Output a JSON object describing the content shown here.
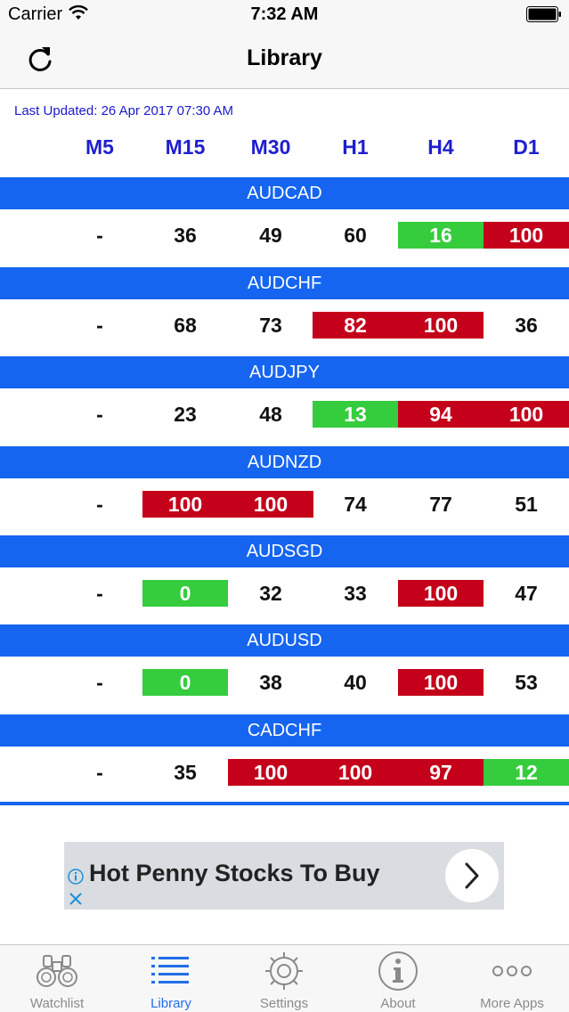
{
  "status": {
    "carrier": "Carrier",
    "time": "7:32 AM"
  },
  "nav": {
    "title": "Library"
  },
  "last_updated": "Last Updated: 26 Apr 2017 07:30 AM",
  "columns": [
    "M5",
    "M15",
    "M30",
    "H1",
    "H4",
    "D1"
  ],
  "pairs": [
    {
      "name": "AUDCAD",
      "values": [
        "-",
        "36",
        "49",
        "60",
        "16",
        "100"
      ],
      "states": [
        "none",
        "none",
        "none",
        "none",
        "green",
        "red"
      ]
    },
    {
      "name": "AUDCHF",
      "values": [
        "-",
        "68",
        "73",
        "82",
        "100",
        "36"
      ],
      "states": [
        "none",
        "none",
        "none",
        "red",
        "red",
        "none"
      ]
    },
    {
      "name": "AUDJPY",
      "values": [
        "-",
        "23",
        "48",
        "13",
        "94",
        "100"
      ],
      "states": [
        "none",
        "none",
        "none",
        "green",
        "red",
        "red"
      ]
    },
    {
      "name": "AUDNZD",
      "values": [
        "-",
        "100",
        "100",
        "74",
        "77",
        "51"
      ],
      "states": [
        "none",
        "red",
        "red",
        "none",
        "none",
        "none"
      ]
    },
    {
      "name": "AUDSGD",
      "values": [
        "-",
        "0",
        "32",
        "33",
        "100",
        "47"
      ],
      "states": [
        "none",
        "green",
        "none",
        "none",
        "red",
        "none"
      ]
    },
    {
      "name": "AUDUSD",
      "values": [
        "-",
        "0",
        "38",
        "40",
        "100",
        "53"
      ],
      "states": [
        "none",
        "green",
        "none",
        "none",
        "red",
        "none"
      ]
    },
    {
      "name": "CADCHF",
      "values": [
        "-",
        "35",
        "100",
        "100",
        "97",
        "12"
      ],
      "states": [
        "none",
        "none",
        "red",
        "red",
        "red",
        "green"
      ]
    }
  ],
  "colors": {
    "header_blue": "#1565f0",
    "red": "#c4001a",
    "green": "#35cc3d",
    "accent": "#1f6ee8"
  },
  "ad": {
    "text": "Hot Penny Stocks To Buy"
  },
  "tabs": [
    {
      "label": "Watchlist",
      "icon": "binoculars-icon",
      "active": false
    },
    {
      "label": "Library",
      "icon": "list-icon",
      "active": true
    },
    {
      "label": "Settings",
      "icon": "gear-icon",
      "active": false
    },
    {
      "label": "About",
      "icon": "info-icon",
      "active": false
    },
    {
      "label": "More Apps",
      "icon": "more-icon",
      "active": false
    }
  ]
}
